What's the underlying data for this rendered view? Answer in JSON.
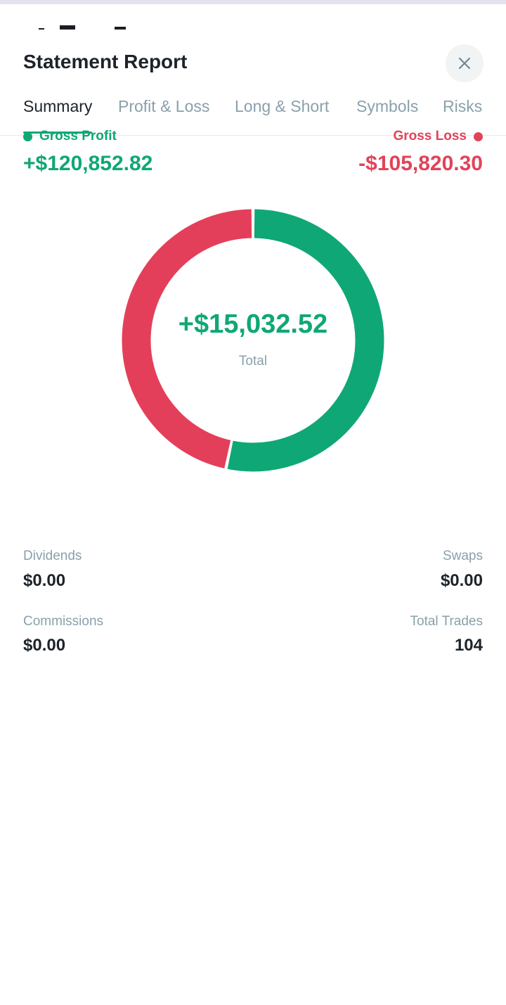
{
  "sheet": {
    "title": "Statement Report",
    "close_icon": "close-icon"
  },
  "tabs": [
    {
      "label": "Summary",
      "active": true
    },
    {
      "label": "Profit & Loss",
      "active": false
    },
    {
      "label": "Long & Short",
      "active": false
    },
    {
      "label": "Symbols",
      "active": false
    },
    {
      "label": "Risks",
      "active": false
    }
  ],
  "summary": {
    "gross_profit_label": "Gross Profit",
    "gross_profit_value": "+$120,852.82",
    "gross_loss_label": "Gross Loss",
    "gross_loss_value": "-$105,820.30",
    "total_value": "+$15,032.52",
    "total_label": "Total",
    "dividends_label": "Dividends",
    "dividends_value": "$0.00",
    "swaps_label": "Swaps",
    "swaps_value": "$0.00",
    "commissions_label": "Commissions",
    "commissions_value": "$0.00",
    "total_trades_label": "Total Trades",
    "total_trades_value": "104"
  },
  "donut": {
    "profit": 120852.82,
    "loss": 105820.3,
    "profit_color": "#0fa776",
    "loss_color": "#e43f5a"
  },
  "colors": {
    "accent_green": "#0fa776",
    "accent_red": "#e14359",
    "muted_text": "#8aa0ab",
    "dark_text": "#1d2329"
  }
}
